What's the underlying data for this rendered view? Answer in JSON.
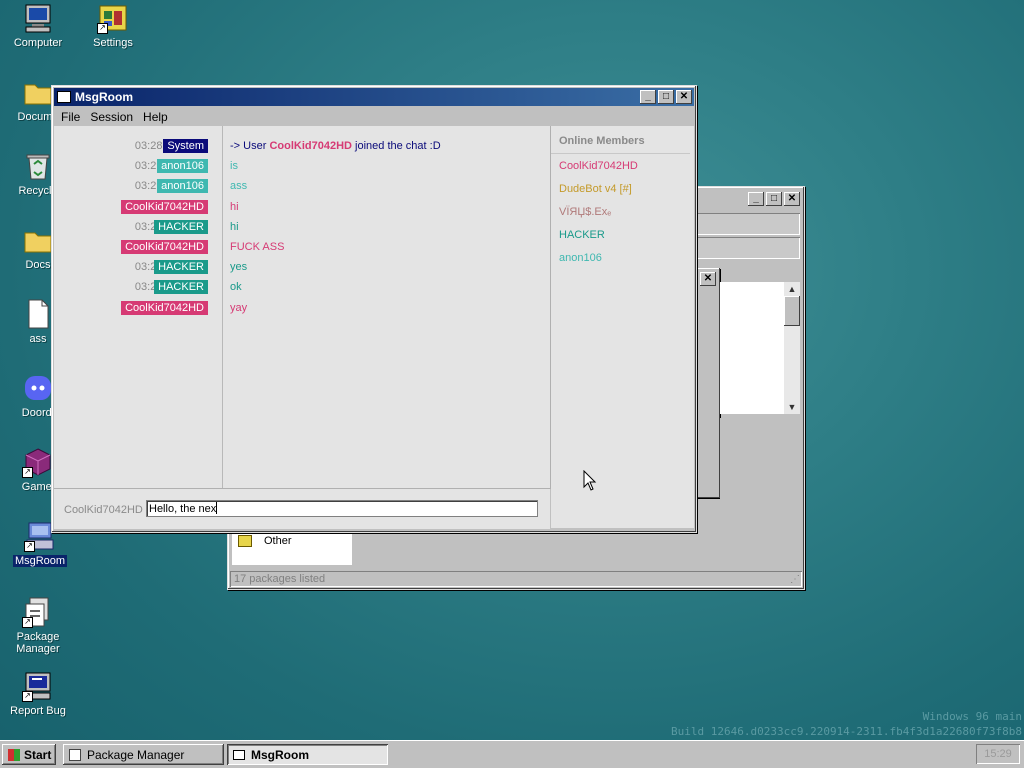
{
  "desktop": {
    "icons": [
      {
        "label": "Computer"
      },
      {
        "label": "Settings"
      },
      {
        "label": "Docume"
      },
      {
        "label": "Recycle"
      },
      {
        "label": "Docs"
      },
      {
        "label": "ass"
      },
      {
        "label": "Doordi"
      },
      {
        "label": "Gamei"
      },
      {
        "label": "MsgRoom"
      },
      {
        "label": "Package\nManager"
      },
      {
        "label": "Report Bug"
      }
    ],
    "build_line1": "Windows 96 main",
    "build_line2": "Build 12646.d0233cc9.220914-2311.fb4f3d1a22680f73f8b8"
  },
  "package_manager": {
    "title": "Package Manager",
    "list_item": "Other",
    "status": "17 packages listed"
  },
  "msgroom": {
    "title": "MsgRoom",
    "menu": [
      "File",
      "Session",
      "Help"
    ],
    "messages": [
      {
        "time": "03:28 PM",
        "user": "System",
        "color": "#0a0a7a",
        "text": "-> User ",
        "highlight": "CoolKid7042HD",
        "text2": " joined the chat :D",
        "text_color": "#0a0a7a"
      },
      {
        "time": "03:29 PM",
        "user": "anon106",
        "color": "#3fb8b0",
        "text": "is",
        "text_color": "#3fb8b0"
      },
      {
        "time": "03:29 PM",
        "user": "anon106",
        "color": "#3fb8b0",
        "text": "ass",
        "text_color": "#3fb8b0"
      },
      {
        "time": "03:29 PM",
        "user": "CoolKid7042HD",
        "color": "#d63a74",
        "text": "hi",
        "text_color": "#d63a74"
      },
      {
        "time": "03:29 PM",
        "user": "HACKER",
        "color": "#1a9a8a",
        "text": "hi",
        "text_color": "#1a9a8a"
      },
      {
        "time": "03:29 PM",
        "user": "CoolKid7042HD",
        "color": "#d63a74",
        "text": "FUCK ASS",
        "text_color": "#d63a74"
      },
      {
        "time": "03:29 PM",
        "user": "HACKER",
        "color": "#1a9a8a",
        "text": "yes",
        "text_color": "#1a9a8a"
      },
      {
        "time": "03:29 PM",
        "user": "HACKER",
        "color": "#1a9a8a",
        "text": "ok",
        "text_color": "#1a9a8a"
      },
      {
        "time": "03:29 PM",
        "user": "CoolKid7042HD",
        "color": "#d63a74",
        "text": "yay",
        "text_color": "#d63a74"
      }
    ],
    "members_header": "Online Members",
    "members": [
      {
        "name": "CoolKid7042HD",
        "color": "#d63a74"
      },
      {
        "name": "DudeBot v4 [#]",
        "color": "#c49a2a"
      },
      {
        "name": "VЇЯЏ$.Exₑ",
        "color": "#b07a7a"
      },
      {
        "name": "HACKER",
        "color": "#1a9a8a"
      },
      {
        "name": "anon106",
        "color": "#3fb8b0"
      }
    ],
    "input_label": "CoolKid7042HD",
    "input_value": "Hello, the nex"
  },
  "taskbar": {
    "start_label": "Start",
    "tasks": [
      {
        "label": "Package Manager"
      },
      {
        "label": "MsgRoom"
      }
    ],
    "clock": "15:29"
  }
}
